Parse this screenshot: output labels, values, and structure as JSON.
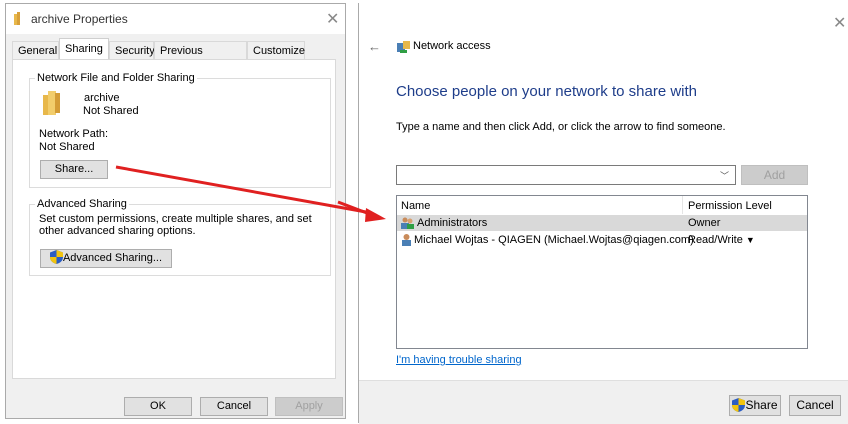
{
  "left_dialog": {
    "title": "archive Properties",
    "tabs": [
      "General",
      "Sharing",
      "Security",
      "Previous Versions",
      "Customize"
    ],
    "active_tab": "Sharing",
    "network_sharing": {
      "legend": "Network File and Folder Sharing",
      "folder_name": "archive",
      "folder_status": "Not Shared",
      "network_path_label": "Network Path:",
      "network_path_value": "Not Shared",
      "share_button": "Share..."
    },
    "advanced_sharing": {
      "legend": "Advanced Sharing",
      "description": "Set custom permissions, create multiple shares, and set other advanced sharing options.",
      "button": "Advanced Sharing..."
    },
    "buttons": {
      "ok": "OK",
      "cancel": "Cancel",
      "apply": "Apply"
    }
  },
  "right_dialog": {
    "title": "Network access",
    "heading": "Choose people on your network to share with",
    "instruction": "Type a name and then click Add, or click the arrow to find someone.",
    "add_button": "Add",
    "columns": {
      "name": "Name",
      "permission": "Permission Level"
    },
    "rows": [
      {
        "name": "Administrators",
        "permission": "Owner",
        "icon": "group-icon"
      },
      {
        "name": "Michael Wojtas - QIAGEN (Michael.Wojtas@qiagen.com)",
        "permission": "Read/Write",
        "icon": "user-icon"
      }
    ],
    "trouble_link": "I'm having trouble sharing",
    "share_button": "Share",
    "cancel_button": "Cancel"
  },
  "colors": {
    "heading": "#1e3d8a",
    "link": "#0066cc",
    "arrow": "#e02020",
    "folder": "#e8b84a"
  }
}
